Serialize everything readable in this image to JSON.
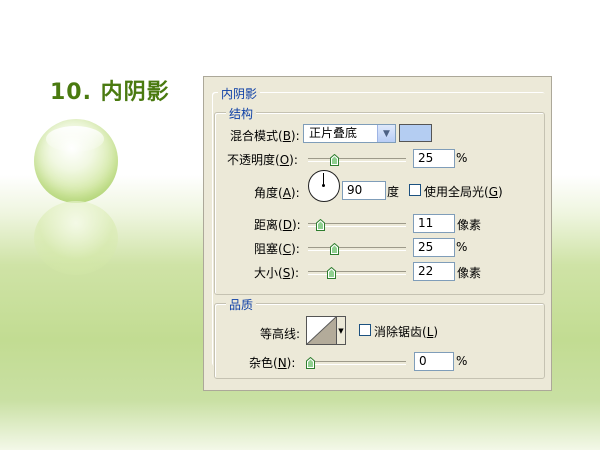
{
  "slide": {
    "title": "10. 内阴影"
  },
  "dialog": {
    "group_title": "内阴影",
    "structure": {
      "title": "结构",
      "blend_mode_label": "混合模式(",
      "blend_mode_key": "B",
      "blend_mode_suffix": "):",
      "blend_mode_value": "正片叠底",
      "shadow_color": "#b4cdf2",
      "opacity_label": "不透明度(",
      "opacity_key": "O",
      "opacity_suffix": "):",
      "opacity_value": "25",
      "opacity_unit": "%",
      "angle_label": "角度(",
      "angle_key": "A",
      "angle_suffix": "):",
      "angle_value": "90",
      "angle_unit": "度",
      "global_light_label": "使用全局光(",
      "global_light_key": "G",
      "global_light_suffix": ")",
      "distance_label": "距离(",
      "distance_key": "D",
      "distance_suffix": "):",
      "distance_value": "11",
      "distance_unit": "像素",
      "choke_label": "阻塞(",
      "choke_key": "C",
      "choke_suffix": "):",
      "choke_value": "25",
      "choke_unit": "%",
      "size_label": "大小(",
      "size_key": "S",
      "size_suffix": "):",
      "size_value": "22",
      "size_unit": "像素"
    },
    "quality": {
      "title": "品质",
      "contour_label": "等高线:",
      "antialias_label": "消除锯齿(",
      "antialias_key": "L",
      "antialias_suffix": ")",
      "noise_label": "杂色(",
      "noise_key": "N",
      "noise_suffix": "):",
      "noise_value": "0",
      "noise_unit": "%"
    },
    "sliders": {
      "opacity": 0.25,
      "distance": 0.11,
      "choke": 0.25,
      "size": 0.22,
      "noise": 0.0
    }
  }
}
